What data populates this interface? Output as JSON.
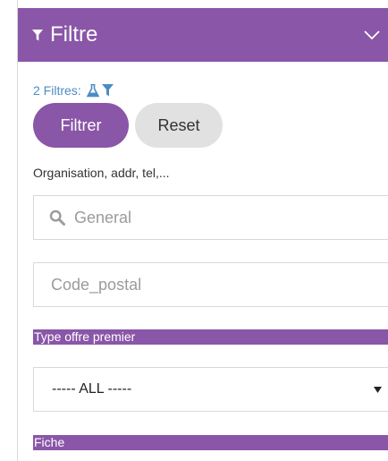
{
  "panel": {
    "title": "Filtre",
    "header_icon": "filter-icon",
    "collapse_icon": "chevron-down-icon"
  },
  "filters": {
    "count_label": "2 Filtres:",
    "icons": [
      "flask-icon",
      "filter-icon"
    ],
    "apply_label": "Filtrer",
    "reset_label": "Reset"
  },
  "search": {
    "hint": "Organisation, addr, tel,...",
    "general_placeholder": "General",
    "general_value": "",
    "postal_placeholder": "Code_postal",
    "postal_value": ""
  },
  "type_offre": {
    "label": "Type offre premier",
    "selected": "----- ALL -----"
  },
  "fiche": {
    "label": "Fiche"
  },
  "colors": {
    "accent": "#8a56a8",
    "link": "#4c8cc4",
    "reset_bg": "#e1e1e1",
    "border": "#d9d9d9"
  }
}
